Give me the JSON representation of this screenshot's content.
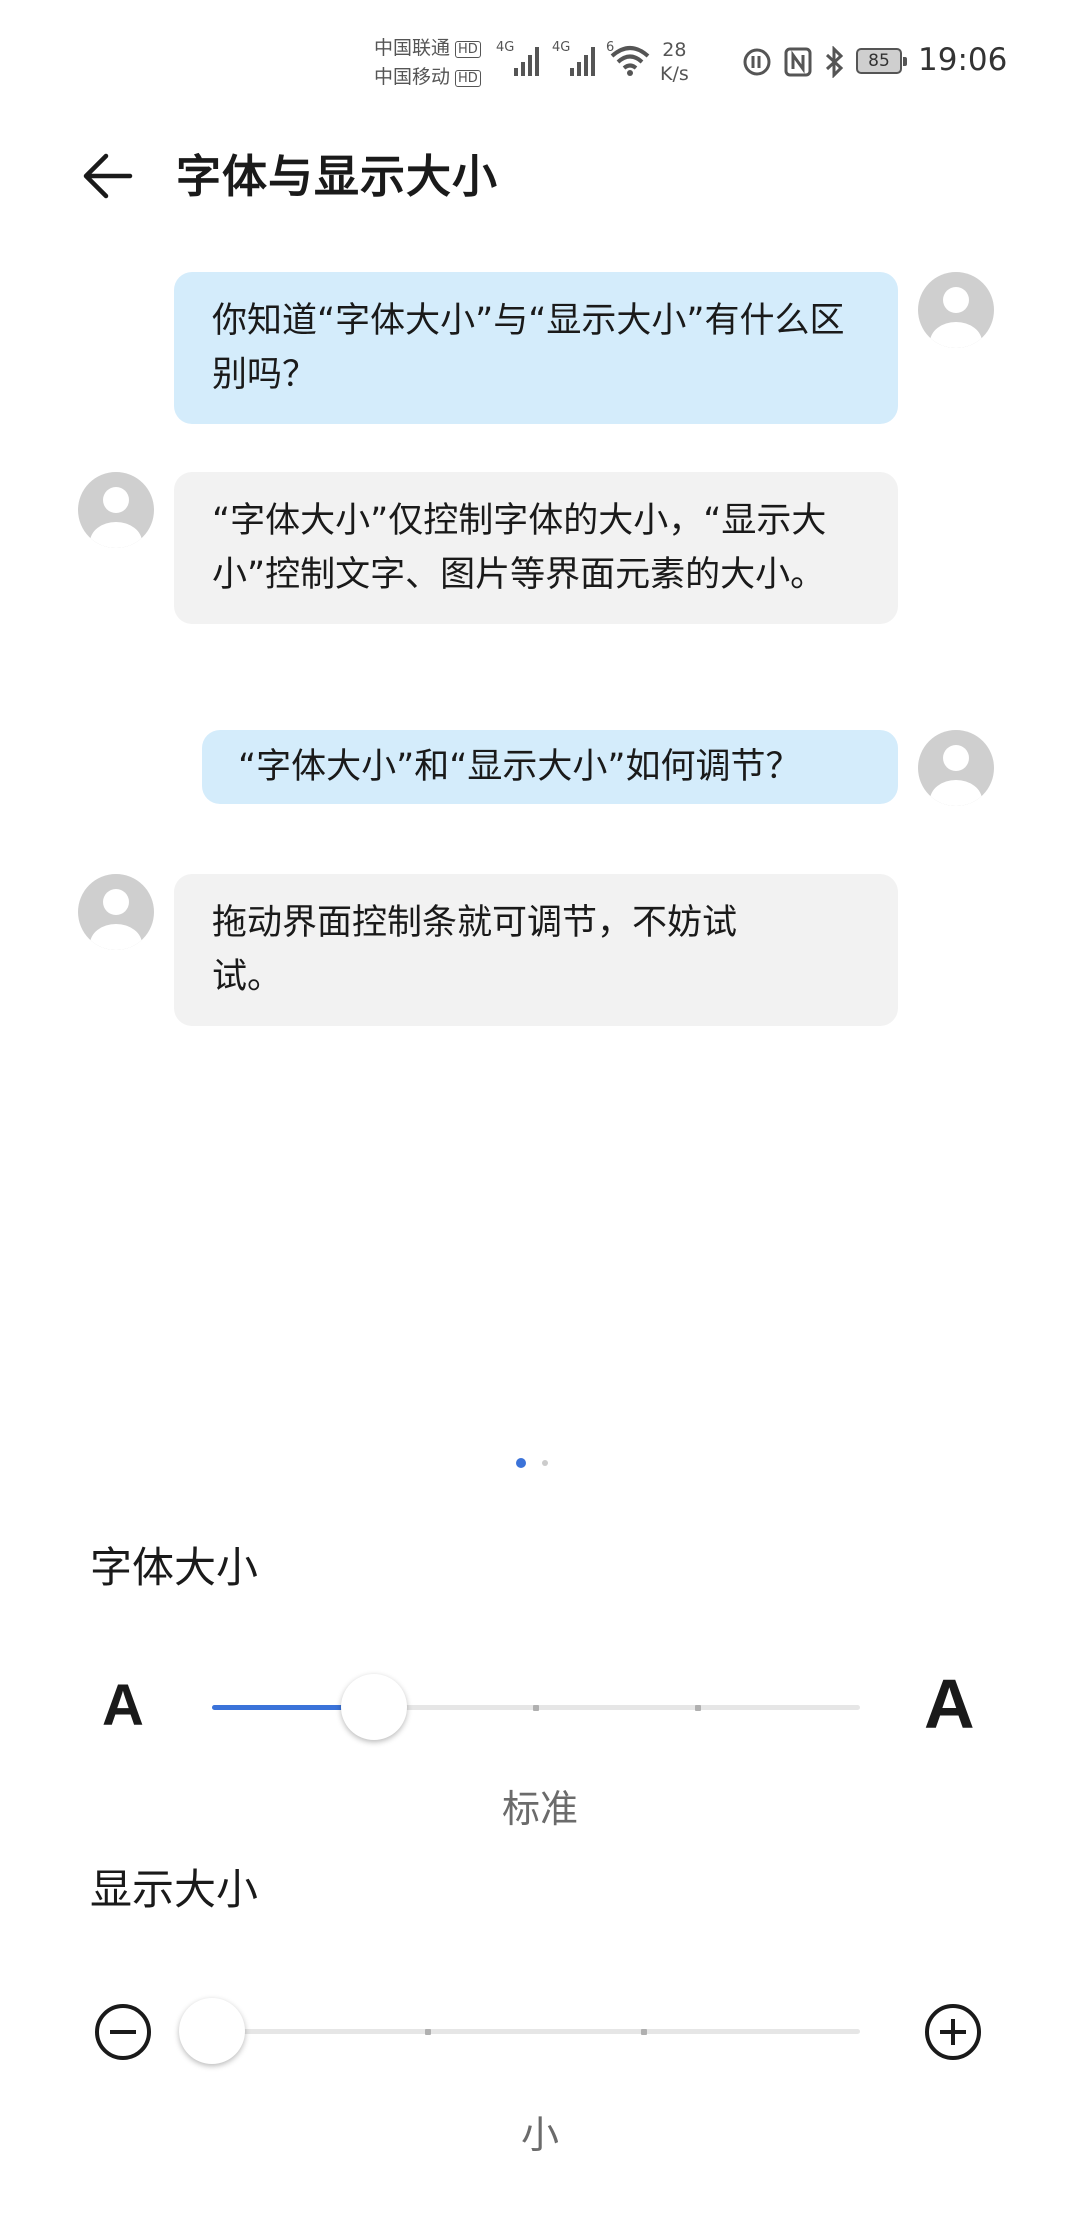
{
  "status_bar": {
    "carrier_1": "中国联通",
    "carrier_2": "中国移动",
    "hd_badge": "HD",
    "network_1": "4G",
    "network_2": "4G",
    "wifi_gen": "6",
    "speed_value": "28",
    "speed_unit": "K/s",
    "battery": "85",
    "time": "19:06",
    "icons": [
      "hd-calling-icon",
      "nfc-icon",
      "bluetooth-icon",
      "signal-icon",
      "wifi-icon"
    ]
  },
  "app_bar": {
    "back_icon": "arrow-left-icon",
    "title": "字体与显示大小"
  },
  "chat": {
    "messages": [
      {
        "sender": "me",
        "text": "你知道“字体大小”与“显示大小”有什么区别吗？"
      },
      {
        "sender": "them",
        "text": "“字体大小”仅控制字体的大小，“显示大小”控制文字、图片等界面元素的大小。"
      },
      {
        "sender": "me",
        "text": "“字体大小”和“显示大小”如何调节？"
      },
      {
        "sender": "them",
        "text": "拖动界面控制条就可调节，不妨试试。"
      }
    ]
  },
  "pager": {
    "count": 2,
    "active": 0
  },
  "font_size": {
    "label": "字体大小",
    "small_glyph": "A",
    "large_glyph": "A",
    "level_index": 1,
    "level_count": 5,
    "value_label": "标准"
  },
  "display_size": {
    "label": "显示大小",
    "decrease_icon": "minus-circle-icon",
    "increase_icon": "plus-circle-icon",
    "level_index": 0,
    "level_count": 4,
    "value_label": "小"
  },
  "colors": {
    "accent": "#3b73d9",
    "my_bubble": "#d4ecfb",
    "their_bubble": "#f2f2f2",
    "avatar": "#cfcfcf"
  }
}
